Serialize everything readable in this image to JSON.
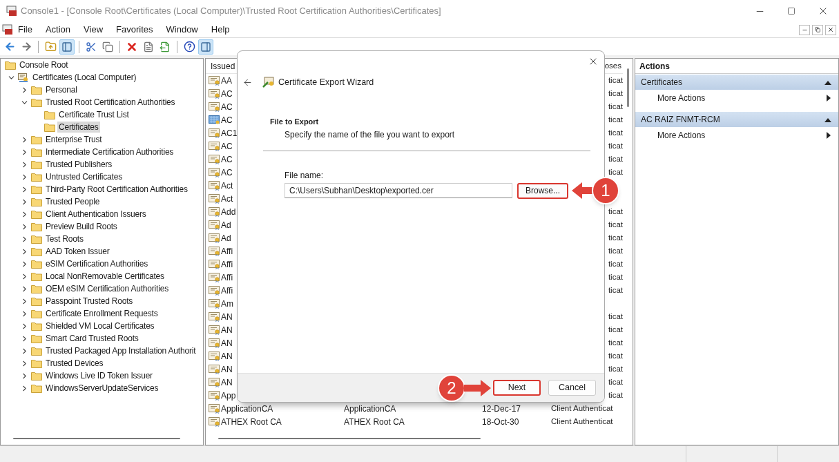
{
  "window": {
    "title": "Console1 - [Console Root\\Certificates (Local Computer)\\Trusted Root Certification Authorities\\Certificates]"
  },
  "menu": [
    "File",
    "Action",
    "View",
    "Favorites",
    "Window",
    "Help"
  ],
  "toolbar": [
    [
      {
        "kind": "back",
        "pressed": false
      },
      {
        "kind": "forward",
        "pressed": false
      }
    ],
    [
      {
        "kind": "up",
        "pressed": false
      },
      {
        "kind": "tree",
        "pressed": true
      }
    ],
    [
      {
        "kind": "cut",
        "pressed": false
      },
      {
        "kind": "copy",
        "pressed": false
      }
    ],
    [
      {
        "kind": "delete",
        "pressed": false
      },
      {
        "kind": "properties",
        "pressed": false
      },
      {
        "kind": "export",
        "pressed": false
      }
    ],
    [
      {
        "kind": "help",
        "pressed": false
      },
      {
        "kind": "actionpane",
        "pressed": true
      }
    ]
  ],
  "tree": [
    {
      "label": "Console Root",
      "kind": "folder",
      "selected": false,
      "children": [
        {
          "label": "Certificates (Local Computer)",
          "kind": "store",
          "expanded": true,
          "selected": false,
          "children": [
            {
              "label": "Personal",
              "kind": "folder",
              "expanded": false,
              "selected": false
            },
            {
              "label": "Trusted Root Certification Authorities",
              "kind": "folder",
              "expanded": true,
              "selected": false,
              "children": [
                {
                  "label": "Certificate Trust List",
                  "kind": "folder",
                  "selected": false
                },
                {
                  "label": "Certificates",
                  "kind": "folder",
                  "selected": true
                }
              ]
            },
            {
              "label": "Enterprise Trust",
              "kind": "folder",
              "expanded": false,
              "selected": false
            },
            {
              "label": "Intermediate Certification Authorities",
              "kind": "folder",
              "expanded": false,
              "selected": false
            },
            {
              "label": "Trusted Publishers",
              "kind": "folder",
              "expanded": false,
              "selected": false
            },
            {
              "label": "Untrusted Certificates",
              "kind": "folder",
              "expanded": false,
              "selected": false
            },
            {
              "label": "Third-Party Root Certification Authorities",
              "kind": "folder",
              "expanded": false,
              "selected": false
            },
            {
              "label": "Trusted People",
              "kind": "folder",
              "expanded": false,
              "selected": false
            },
            {
              "label": "Client Authentication Issuers",
              "kind": "folder",
              "expanded": false,
              "selected": false
            },
            {
              "label": "Preview Build Roots",
              "kind": "folder",
              "expanded": false,
              "selected": false
            },
            {
              "label": "Test Roots",
              "kind": "folder",
              "expanded": false,
              "selected": false
            },
            {
              "label": "AAD Token Issuer",
              "kind": "folder",
              "expanded": false,
              "selected": false
            },
            {
              "label": "eSIM Certification Authorities",
              "kind": "folder",
              "expanded": false,
              "selected": false
            },
            {
              "label": "Local NonRemovable Certificates",
              "kind": "folder",
              "expanded": false,
              "selected": false
            },
            {
              "label": "OEM eSIM Certification Authorities",
              "kind": "folder",
              "expanded": false,
              "selected": false
            },
            {
              "label": "Passpoint Trusted Roots",
              "kind": "folder",
              "expanded": false,
              "selected": false
            },
            {
              "label": "Certificate Enrollment Requests",
              "kind": "folder",
              "expanded": false,
              "selected": false
            },
            {
              "label": "Shielded VM Local Certificates",
              "kind": "folder",
              "expanded": false,
              "selected": false
            },
            {
              "label": "Smart Card Trusted Roots",
              "kind": "folder",
              "expanded": false,
              "selected": false
            },
            {
              "label": "Trusted Packaged App Installation Authorit",
              "kind": "folder",
              "expanded": false,
              "selected": false
            },
            {
              "label": "Trusted Devices",
              "kind": "folder",
              "expanded": false,
              "selected": false
            },
            {
              "label": "Windows Live ID Token Issuer",
              "kind": "folder",
              "expanded": false,
              "selected": false
            },
            {
              "label": "WindowsServerUpdateServices",
              "kind": "folder",
              "expanded": false,
              "selected": false
            }
          ]
        }
      ]
    }
  ],
  "list": {
    "columns": [
      "Issued",
      "oses"
    ],
    "rows": [
      {
        "name": "AA",
        "purpose": "ticat",
        "selected": false
      },
      {
        "name": "AC",
        "purpose": "ticat",
        "selected": false
      },
      {
        "name": "AC",
        "purpose": "ticat",
        "selected": false
      },
      {
        "name": "AC",
        "purpose": "ticat",
        "selected": true
      },
      {
        "name": "AC1",
        "purpose": "ticat",
        "selected": false
      },
      {
        "name": "AC",
        "purpose": "ticat",
        "selected": false
      },
      {
        "name": "AC",
        "purpose": "ticat",
        "selected": false
      },
      {
        "name": "AC",
        "purpose": "ticat",
        "selected": false
      },
      {
        "name": "Act",
        "selected": false
      },
      {
        "name": "Act",
        "selected": false
      },
      {
        "name": "Add",
        "purpose": "ticat",
        "selected": false
      },
      {
        "name": "Ad",
        "purpose": "ticat",
        "selected": false
      },
      {
        "name": "Ad",
        "purpose": "ticat",
        "selected": false
      },
      {
        "name": "Affi",
        "purpose": "ticat",
        "selected": false
      },
      {
        "name": "Affi",
        "purpose": "ticat",
        "selected": false
      },
      {
        "name": "Affi",
        "purpose": "ticat",
        "selected": false
      },
      {
        "name": "Affi",
        "purpose": "ticat",
        "selected": false
      },
      {
        "name": "Am",
        "selected": false
      },
      {
        "name": "AN",
        "purpose": "ticat",
        "selected": false
      },
      {
        "name": "AN",
        "purpose": "ticat",
        "selected": false
      },
      {
        "name": "AN",
        "purpose": "ticat",
        "selected": false
      },
      {
        "name": "AN",
        "purpose": "ticat",
        "selected": false
      },
      {
        "name": "AN",
        "purpose": "ticat",
        "selected": false
      },
      {
        "name": "AN",
        "purpose": "ticat",
        "selected": false
      },
      {
        "name": "App",
        "purpose": "ticat",
        "selected": false
      },
      {
        "name": "ApplicationCA",
        "issued_by": "ApplicationCA",
        "expiration": "12-Dec-17",
        "purpose": "Client Authenticat",
        "selected": false
      },
      {
        "name": "ATHEX Root CA",
        "issued_by": "ATHEX Root CA",
        "expiration": "18-Oct-30",
        "purpose": "Client Authenticat",
        "selected": false
      }
    ]
  },
  "dialog": {
    "title": "Certificate Export Wizard",
    "section_title": "File to Export",
    "section_subtitle": "Specify the name of the file you want to export",
    "field_label": "File name:",
    "file_name": "C:\\Users\\Subhan\\Desktop\\exported.cer",
    "browse": {
      "label": "Browse...",
      "highlighted": true,
      "callout": {
        "number": "1",
        "kind": "leftward"
      }
    },
    "buttons": [
      {
        "label": "Next",
        "highlighted": true,
        "callout": {
          "number": "2",
          "kind": "rightward"
        }
      },
      {
        "label": "Cancel",
        "highlighted": false
      }
    ]
  },
  "actions": {
    "title": "Actions",
    "sections": [
      {
        "title": "Certificates",
        "expanded": true,
        "items": [
          "More Actions"
        ]
      },
      {
        "title": "AC RAIZ FNMT-RCM",
        "expanded": true,
        "items": [
          "More Actions"
        ]
      }
    ]
  }
}
